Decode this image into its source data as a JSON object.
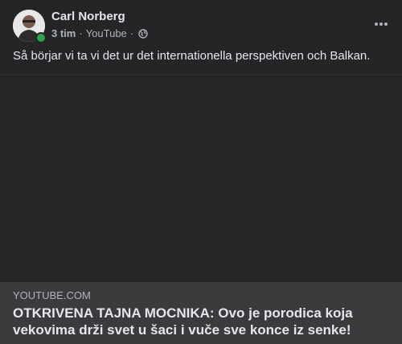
{
  "post": {
    "author": "Carl Norberg",
    "time": "3 tim",
    "source": "YouTube",
    "privacy_icon": "globe-icon",
    "more_icon": "more-options-icon",
    "text": "Så börjar vi ta vi det ur det internationella perspektiven och Balkan."
  },
  "link_preview": {
    "domain": "YOUTUBE.COM",
    "title": "OTKRIVENA TAJNA MOCNIKA: Ovo je porodica koja vekovima drži svet u šaci i vuče sve konce iz senke!"
  },
  "colors": {
    "background": "#242526",
    "online": "#31a24c",
    "link_box": "#3a3b3c"
  }
}
